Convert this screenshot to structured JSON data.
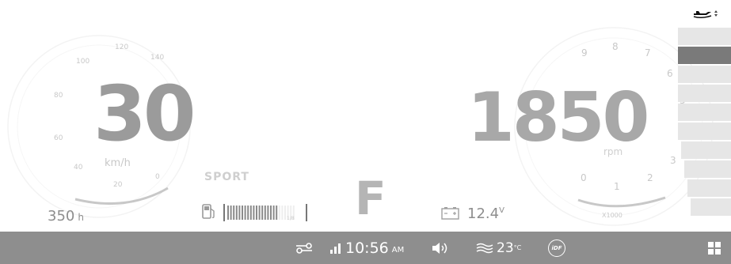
{
  "speedometer": {
    "speed": "30",
    "unit": "km/h",
    "ticks": [
      "20",
      "40",
      "60",
      "80",
      "100",
      "120",
      "140",
      "0"
    ]
  },
  "hours": {
    "value": "350",
    "unit": "h"
  },
  "drive_mode": "SPORT",
  "fuel": {
    "level": 0.75,
    "empty_mark": "1/8"
  },
  "gear": "F",
  "battery": {
    "voltage": "12.4",
    "unit": "V"
  },
  "tachometer": {
    "rpm": "1850",
    "unit": "rpm",
    "scale_label": "X1000",
    "ticks": [
      "0",
      "1",
      "2",
      "3",
      "4",
      "5",
      "6",
      "7",
      "8",
      "9"
    ]
  },
  "status_bar": {
    "time": "10:56",
    "ampm": "AM",
    "temperature": "23",
    "temperature_unit": "°C",
    "idf_label": "iDF"
  },
  "trim_bars": {
    "count": 10,
    "active_index": 1
  },
  "colors": {
    "status_bar_bg": "#8e8e8e",
    "digits": "#9b9b9b",
    "trim_active": "#7a7a7a"
  }
}
